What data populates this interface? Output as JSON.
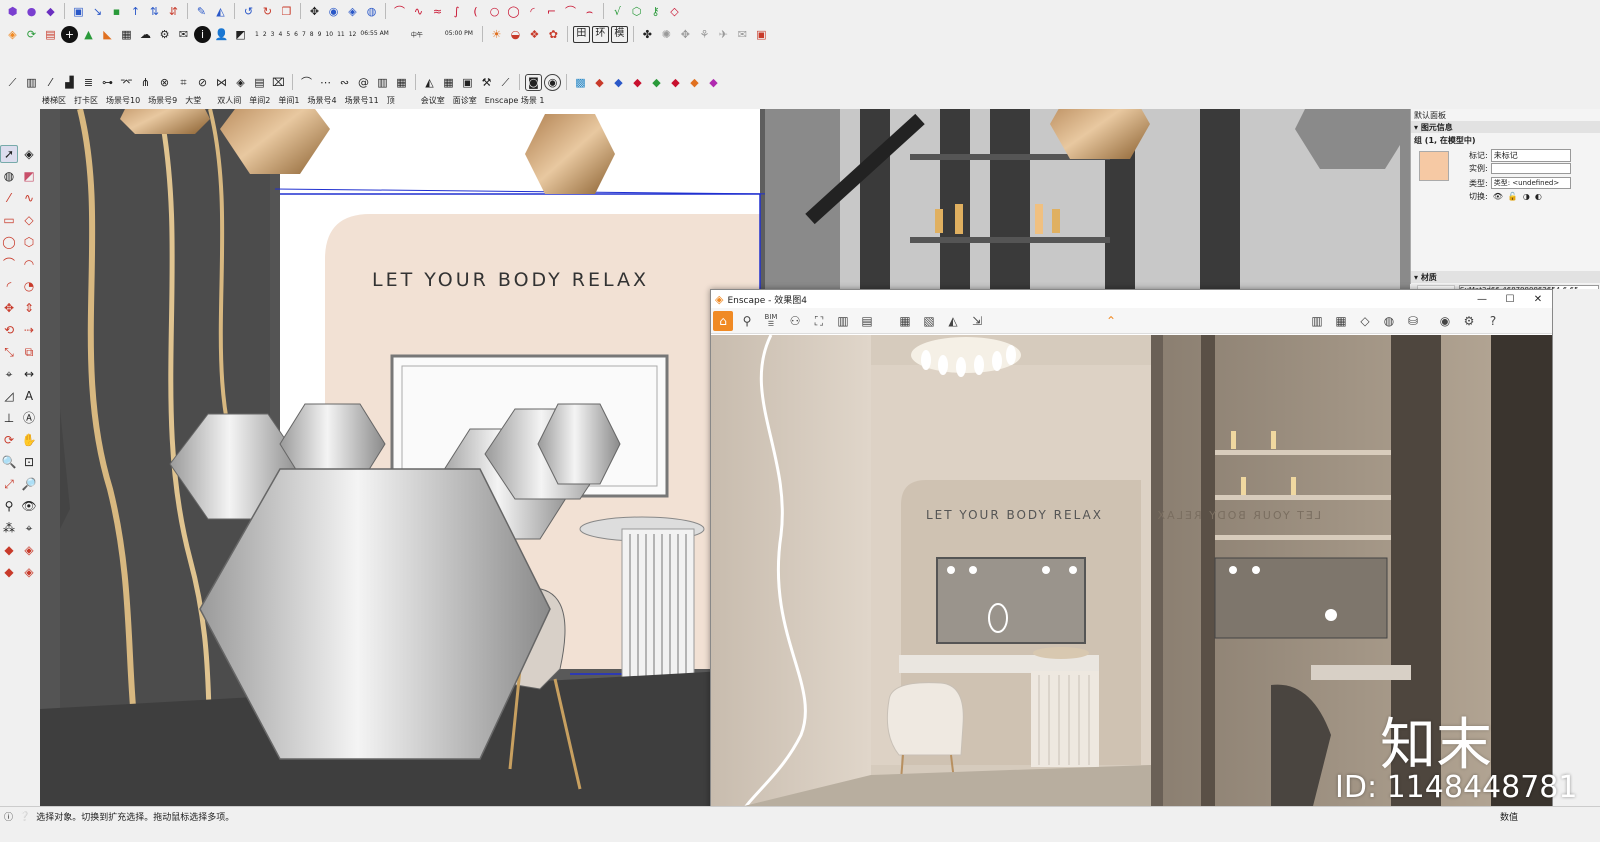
{
  "toolbar1": {
    "icons": [
      "cube-purple-icon",
      "sphere-purple-icon",
      "cube-blue-icon",
      "arrow-blue-icon",
      "arrow-pair-icon",
      "arrow-red-icon",
      "pencil-icon",
      "triangle-icon",
      "undo-icon",
      "redo-icon",
      "paper-icon",
      "move-icon",
      "orbit-icon",
      "box-icon",
      "arc-icon",
      "spline-icon",
      "circle-icon",
      "polygon-icon",
      "curve-icon",
      "key-icon"
    ]
  },
  "toolbar2": {
    "time_scale": [
      "1",
      "2",
      "3",
      "4",
      "5",
      "6",
      "7",
      "8",
      "9",
      "10",
      "11",
      "12"
    ],
    "time_left": "06:55 AM",
    "time_mid": "中午",
    "time_right": "05:00 PM",
    "buttons": [
      "田",
      "环",
      "模"
    ]
  },
  "scene_tabs": [
    "楼梯区",
    "打卡区",
    "场景号10",
    "场景号9",
    "大堂",
    "双人间",
    "单间2",
    "单间1",
    "场景号4",
    "场景号11",
    "顶",
    "会议室",
    "面诊室",
    "Enscape 场景 1"
  ],
  "tray": {
    "title": "默认面板",
    "section_entity": "图元信息",
    "entity_name": "组 (1, 在模型中)",
    "tag_label": "标记:",
    "tag_value": "未标记",
    "instance_label": "实例:",
    "instance_value": "",
    "type_label": "类型:",
    "type_value": "类型: <undefined>",
    "toggle_label": "切换:",
    "swatch_color": "#f6c9a4",
    "section_material": "材质",
    "material_name": "SuMat3d66-4687980862654-6-65"
  },
  "sketch_view": {
    "wall_text": "LET YOUR BODY RELAX"
  },
  "enscape": {
    "title": "Enscape - 效果图4",
    "bim_label": "BIM",
    "wall_text": "LET YOUR BODY RELAX",
    "mirror_text": "LET YOUR BODY RELAX"
  },
  "status": {
    "message": "选择对象。切换到扩充选择。拖动鼠标选择多项。",
    "value_label": "数值"
  },
  "watermark": {
    "logo": "知末",
    "id_text": "ID: 1148448781"
  }
}
